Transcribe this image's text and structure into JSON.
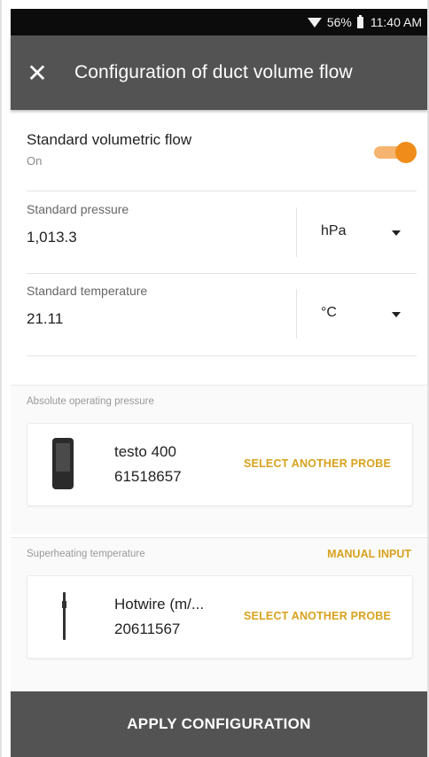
{
  "status_bar": {
    "battery": "56%",
    "time": "11:40 AM",
    "icons": [
      "wifi-icon",
      "battery-icon"
    ]
  },
  "toolbar": {
    "close_icon": "close-icon",
    "title": "Configuration of duct volume flow"
  },
  "standard_flow": {
    "label": "Standard volumetric flow",
    "state": "On",
    "enabled": true,
    "accent": "#f08c1a"
  },
  "standard_pressure": {
    "label": "Standard pressure",
    "value": "1,013.3",
    "unit": "hPa"
  },
  "standard_temperature": {
    "label": "Standard temperature",
    "value": "21.11",
    "unit": "°C"
  },
  "absolute_pressure": {
    "section_label": "Absolute operating pressure",
    "probe_name": "testo 400",
    "probe_serial": "61518657",
    "select_label": "SELECT ANOTHER PROBE"
  },
  "superheating": {
    "section_label": "Superheating temperature",
    "manual_label": "MANUAL INPUT",
    "probe_name": "Hotwire (m/...",
    "probe_serial": "20611567",
    "select_label": "SELECT ANOTHER PROBE"
  },
  "footer": {
    "apply_label": "APPLY CONFIGURATION"
  },
  "colors": {
    "toolbar": "#535353",
    "link": "#d8a21e"
  }
}
